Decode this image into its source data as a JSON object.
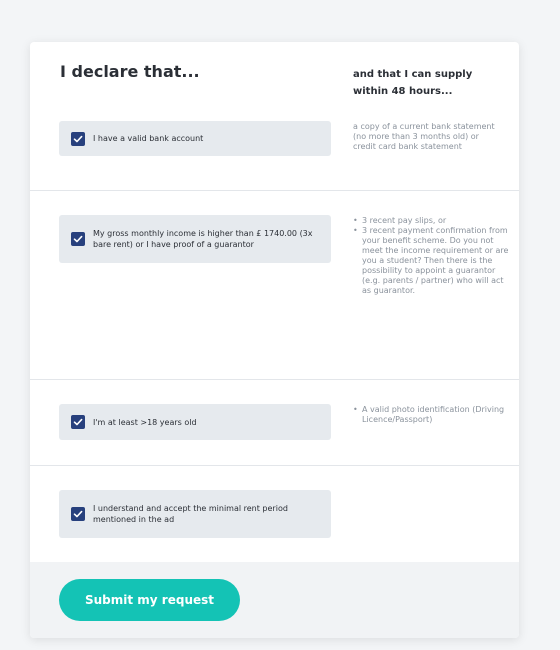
{
  "form": {
    "title": "I declare that...",
    "right_heading": "and that I can supply within 48 hours...",
    "declarations": [
      {
        "label": "I have a valid bank account",
        "checked": true,
        "requirement_text": "a copy of a current bank statement (no more than 3 months old) or credit card bank statement"
      },
      {
        "label": "My gross monthly income is higher than £ 1740.00 (3x bare rent) or I have proof of a guarantor",
        "checked": true,
        "requirement_items": [
          "3 recent pay slips, or",
          "3 recent payment confirmation from your benefit scheme. Do you not meet the income requirement or are you a student? Then there is the possibility to appoint a guarantor (e.g. parents / partner) who will act as guarantor."
        ]
      },
      {
        "label": "I'm at least >18 years old",
        "checked": true,
        "requirement_items": [
          "A valid photo identification (Driving Licence/Passport)"
        ]
      },
      {
        "label": "I understand and accept the minimal rent period mentioned in the ad",
        "checked": true
      }
    ],
    "submit_label": "Submit my request"
  },
  "colors": {
    "accent": "#14c3b5",
    "checkbox": "#27407d",
    "row_bg": "#e6eaee",
    "page_bg": "#f3f5f7"
  }
}
